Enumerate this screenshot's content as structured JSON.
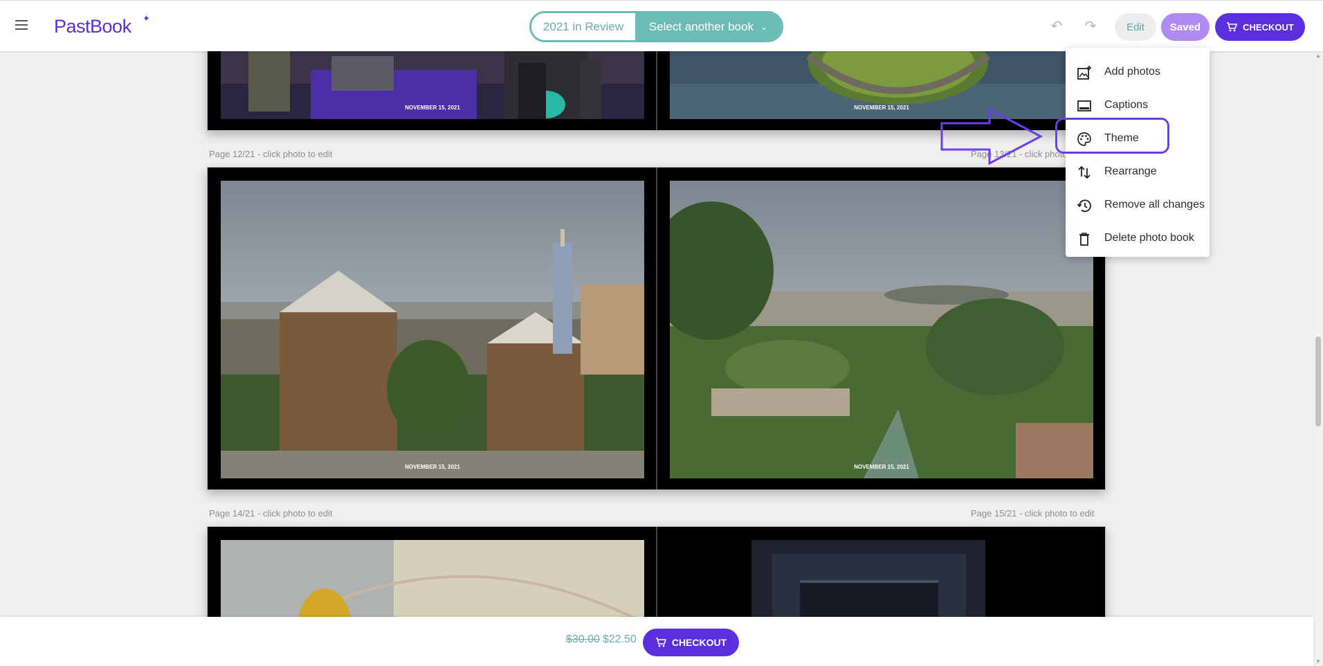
{
  "header": {
    "logo_text": "PastBook",
    "current_book": "2021 in Review",
    "select_book_label": "Select another book",
    "edit_label": "Edit",
    "saved_label": "Saved",
    "checkout_label": "CHECKOUT"
  },
  "pages": {
    "p12": "Page 12/21  - click photo to edit",
    "p13": "Page 13/21  - click photo to edit",
    "p14": "Page 14/21  - click photo to edit",
    "p15": "Page 15/21  - click photo to edit"
  },
  "photo_captions": {
    "top_left": "NOVEMBER 15, 2021",
    "top_right": "NOVEMBER 15, 2021",
    "mid_left": "NOVEMBER 15, 2021",
    "mid_right": "NOVEMBER 15, 2021"
  },
  "edit_menu": {
    "items": [
      {
        "label": "Add photos",
        "icon": "add-photo-icon"
      },
      {
        "label": "Captions",
        "icon": "captions-icon"
      },
      {
        "label": "Theme",
        "icon": "palette-icon"
      },
      {
        "label": "Rearrange",
        "icon": "swap-vertical-icon"
      },
      {
        "label": "Remove all changes",
        "icon": "history-icon"
      },
      {
        "label": "Delete photo book",
        "icon": "trash-icon"
      }
    ]
  },
  "footer": {
    "old_price": "$30.00",
    "new_price": "$22.50",
    "checkout_label": "CHECKOUT"
  },
  "colors": {
    "brand": "#5b2fe0",
    "teal": "#6bbcb5",
    "saved": "#b08bf3",
    "annotation": "#6a3ee8"
  }
}
